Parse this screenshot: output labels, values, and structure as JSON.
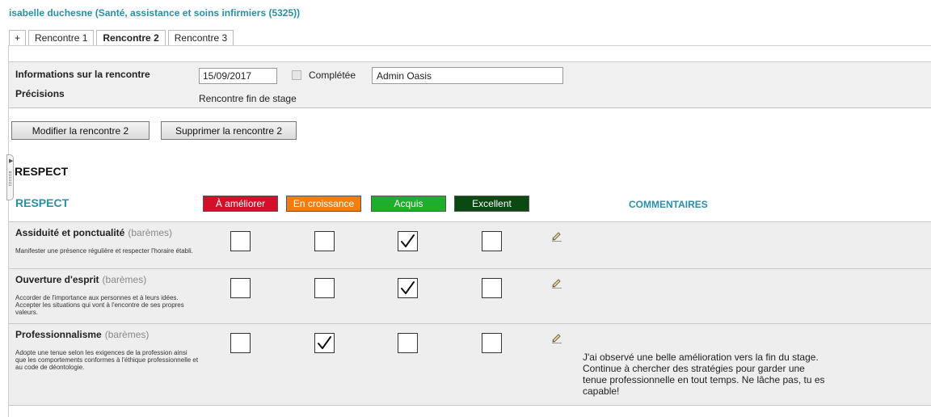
{
  "student": {
    "title": "isabelle duchesne (Santé, assistance et soins infirmiers (5325))"
  },
  "tabs": [
    {
      "label": "+"
    },
    {
      "label": "Rencontre 1"
    },
    {
      "label": "Rencontre 2",
      "active": true
    },
    {
      "label": "Rencontre 3"
    }
  ],
  "meeting": {
    "info_label": "Informations sur la rencontre",
    "date": "15/09/2017",
    "completed_label": "Complétée",
    "completed": false,
    "user": "Admin Oasis",
    "precisions_label": "Précisions",
    "precisions_value": "Rencontre fin de stage"
  },
  "actions": {
    "modify_label": "Modifier la rencontre 2",
    "delete_label": "Supprimer la rencontre 2"
  },
  "section": {
    "title": "RESPECT",
    "grid_title": "RESPECT",
    "levels": [
      {
        "label": "À améliorer",
        "color": "#d2102a"
      },
      {
        "label": "En croissance",
        "color": "#f47d10"
      },
      {
        "label": "Acquis",
        "color": "#1fae2c"
      },
      {
        "label": "Excellent",
        "color": "#0a4a12"
      }
    ],
    "comments_header": "COMMENTAIRES"
  },
  "criteria": [
    {
      "name": "Assiduité et ponctualité",
      "bareme": "(barèmes)",
      "description": "Manifester une présence régulière et respecter l'horaire établi.",
      "selected_level": 2,
      "comment": ""
    },
    {
      "name": "Ouverture d'esprit",
      "bareme": "(barèmes)",
      "description": "Accorder de l'importance aux personnes et à leurs idées. Accepter les situations qui vont à l'encontre de ses propres valeurs.",
      "selected_level": 2,
      "comment": ""
    },
    {
      "name": "Professionnalisme",
      "bareme": "(barèmes)",
      "description": "Adopte une tenue selon les exigences de la profession ainsi que les comportements conformes à l'éthique professionnelle et au code de déontologie.",
      "selected_level": 1,
      "comment": "J'ai observé une belle amélioration vers la fin du stage. Continue à chercher des stratégies pour garder une tenue professionnelle en tout temps. Ne lâche pas, tu es capable!"
    }
  ],
  "icons": {
    "edit": "pencil-icon",
    "check": "check-icon",
    "handle": "side-panel-handle"
  }
}
